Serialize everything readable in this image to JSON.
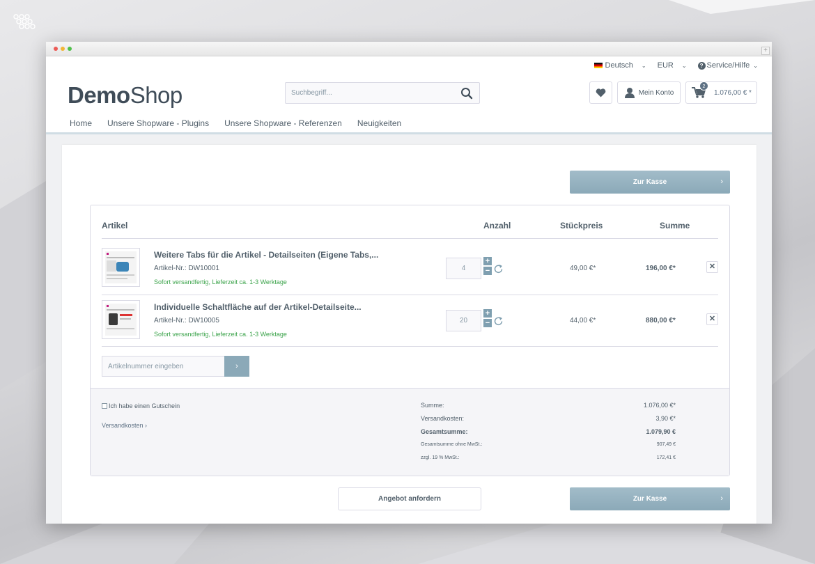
{
  "header": {
    "language": "Deutsch",
    "currency": "EUR",
    "service": "Service/Hilfe",
    "logo_bold": "Demo",
    "logo_light": "Shop",
    "search_placeholder": "Suchbegriff...",
    "account_label": "Mein Konto",
    "cart_count": "2",
    "cart_amount": "1.076,00 € *"
  },
  "nav": {
    "items": [
      "Home",
      "Unsere Shopware - Plugins",
      "Unsere Shopware - Referenzen",
      "Neuigkeiten"
    ]
  },
  "checkout_label": "Zur Kasse",
  "table": {
    "headers": {
      "article": "Artikel",
      "quantity": "Anzahl",
      "unit_price": "Stückpreis",
      "total": "Summe"
    },
    "rows": [
      {
        "name": "Weitere Tabs für die Artikel - Detailseiten (Eigene Tabs,...",
        "number": "Artikel-Nr.: DW10001",
        "shipping": "Sofort versandfertig, Lieferzeit ca. 1-3 Werktage",
        "quantity": "4",
        "unit_price": "49,00 €*",
        "total": "196,00 €*"
      },
      {
        "name": "Individuelle Schaltfläche auf der Artikel-Detailseite...",
        "number": "Artikel-Nr.: DW10005",
        "shipping": "Sofort versandfertig, Lieferzeit ca. 1-3 Werktage",
        "quantity": "20",
        "unit_price": "44,00 €*",
        "total": "880,00 €*"
      }
    ],
    "article_input_placeholder": "Artikelnummer eingeben"
  },
  "aggregation": {
    "voucher_label": "Ich habe einen Gutschein",
    "shipping_link": "Versandkosten",
    "lines": [
      {
        "label": "Summe:",
        "value": "1.076,00 €*"
      },
      {
        "label": "Versandkosten:",
        "value": "3,90 €*"
      },
      {
        "label": "Gesamtsumme:",
        "value": "1.079,90 €"
      },
      {
        "label": "Gesamtsumme ohne MwSt.:",
        "value": "907,49 €"
      },
      {
        "label": "zzgl. 19 % MwSt.:",
        "value": "172,41 €"
      }
    ]
  },
  "offer_button": "Angebot anfordern",
  "colors": {
    "accent": "#8ba9b8",
    "text": "#52606b",
    "success": "#3ba34a"
  }
}
